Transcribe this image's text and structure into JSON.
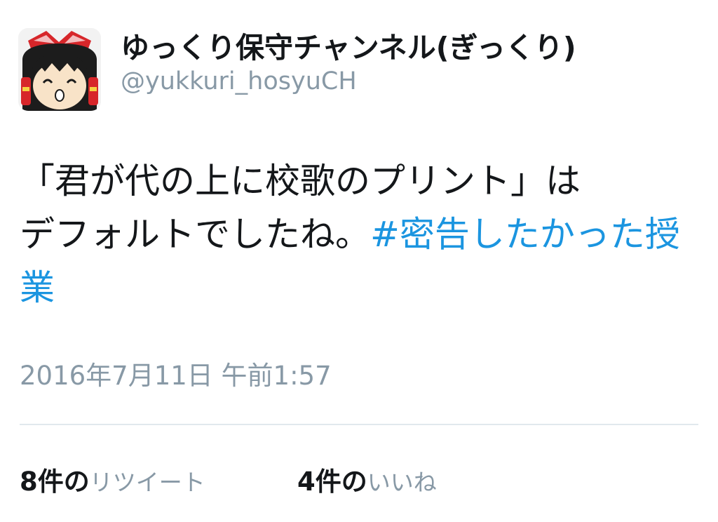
{
  "user": {
    "display_name": "ゆっくり保守チャンネル(ぎっくり)",
    "handle": "@yukkuri_hosyuCH",
    "avatar_icon": "yukkuri-character-avatar-icon"
  },
  "tweet": {
    "line1": "「君が代の上に校歌のプリント」は",
    "line2_text": "デフォルトでしたね。",
    "hashtag": "#密告したかった授業",
    "timestamp": "2016年7月11日 午前1:57"
  },
  "stats": {
    "retweets_count": "8件の",
    "retweets_label": "リツイート",
    "likes_count": "4件の",
    "likes_label": "いいね"
  },
  "colors": {
    "text": "#14171a",
    "muted": "#8899a6",
    "hashtag": "#1b95e0",
    "divider": "#e1e8ed"
  }
}
